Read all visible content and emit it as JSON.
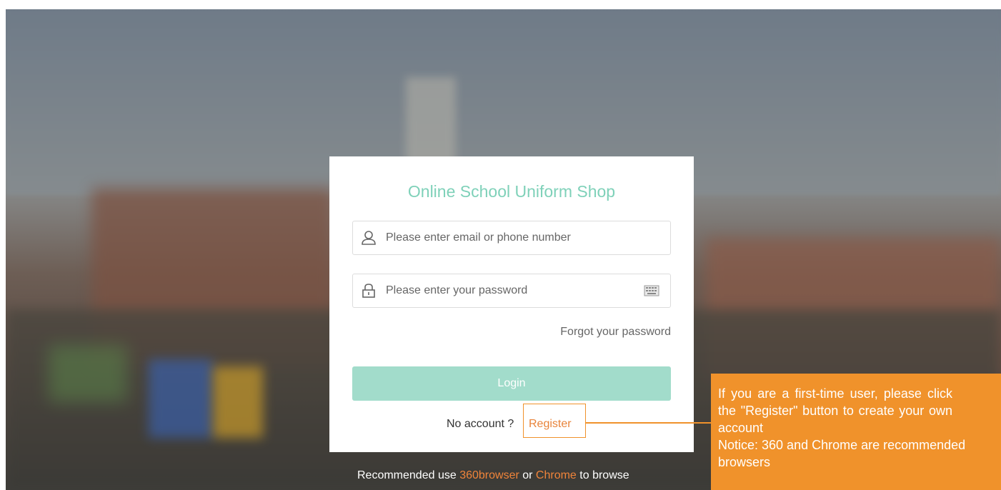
{
  "app": {
    "title": "Online School Uniform Shop"
  },
  "login_form": {
    "username_placeholder": "Please enter email or phone number",
    "password_placeholder": "Please enter your password",
    "forgot_password_label": "Forgot your password",
    "login_button_label": "Login",
    "no_account_text": "No account ?",
    "register_label": "Register"
  },
  "callout": {
    "line1": "If you are a first-time user, please click the \"Register\" button to create your own account",
    "line2": "Notice: 360 and Chrome are recommended browsers"
  },
  "footer": {
    "prefix": "Recommended use ",
    "browser1": "360browser",
    "middle": " or ",
    "browser2": "Chrome",
    "suffix": " to browse"
  },
  "colors": {
    "accent_teal": "#7fd1b9",
    "login_button": "#a2dccb",
    "highlight_orange": "#f0922b"
  },
  "icons": {
    "username": "user-icon",
    "password": "lock-icon",
    "keyboard": "keyboard-icon"
  }
}
